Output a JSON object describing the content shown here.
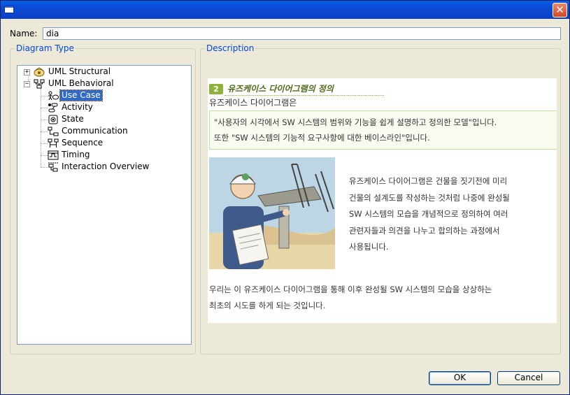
{
  "dialog": {
    "close_glyph": "✕"
  },
  "name_field": {
    "label": "Name:",
    "value": "dia"
  },
  "diagram_type": {
    "title": "Diagram Type",
    "tree": [
      {
        "label": "UML Structural",
        "expanded": false,
        "icon": "uml-structural-icon"
      },
      {
        "label": "UML Behavioral",
        "expanded": true,
        "icon": "uml-behavioral-icon",
        "children": [
          {
            "label": "Use Case",
            "icon": "use-case-icon",
            "selected": true
          },
          {
            "label": "Activity",
            "icon": "activity-icon"
          },
          {
            "label": "State",
            "icon": "state-icon"
          },
          {
            "label": "Communication",
            "icon": "communication-icon"
          },
          {
            "label": "Sequence",
            "icon": "sequence-icon"
          },
          {
            "label": "Timing",
            "icon": "timing-icon"
          },
          {
            "label": "Interaction Overview",
            "icon": "interaction-overview-icon"
          }
        ]
      }
    ],
    "expander_collapsed": "+",
    "expander_expanded": "−"
  },
  "description": {
    "title": "Description",
    "section_number": "2",
    "section_title": "유즈케이스 다이어그램의 정의",
    "subtitle": "유즈케이스 다이어그램은",
    "quote_line1": "\"사용자의 시각에서 SW 시스템의 범위와 기능을 쉽게 설명하고 정의한 모델\"입니다.",
    "quote_line2": "또한 \"SW 시스템의 기능적 요구사항에 대한 베이스라인\"입니다.",
    "body_line1": "유즈케이스 다이어그램은 건물을 짓기전에 미리",
    "body_line2": "건물의 설계도를 작성하는 것처럼 나중에 완성될",
    "body_line3": "SW 시스템의 모습을 개념적으로 정의하여 여러",
    "body_line4": "관련자들과 의견을 나누고 합의하는 과정에서",
    "body_line5": "사용됩니다.",
    "bottom_line1": "우리는 이 유즈케이스 다이어그램을 통해 이후 완성될 SW 시스템의 모습을 상상하는",
    "bottom_line2": "최초의 시도를 하게 되는 것입니다."
  },
  "buttons": {
    "ok": "OK",
    "cancel": "Cancel"
  },
  "colors": {
    "titlebar": "#0a4bd6",
    "group_title": "#0046d5",
    "selection": "#316ac5",
    "accent_green": "#8db33a"
  }
}
